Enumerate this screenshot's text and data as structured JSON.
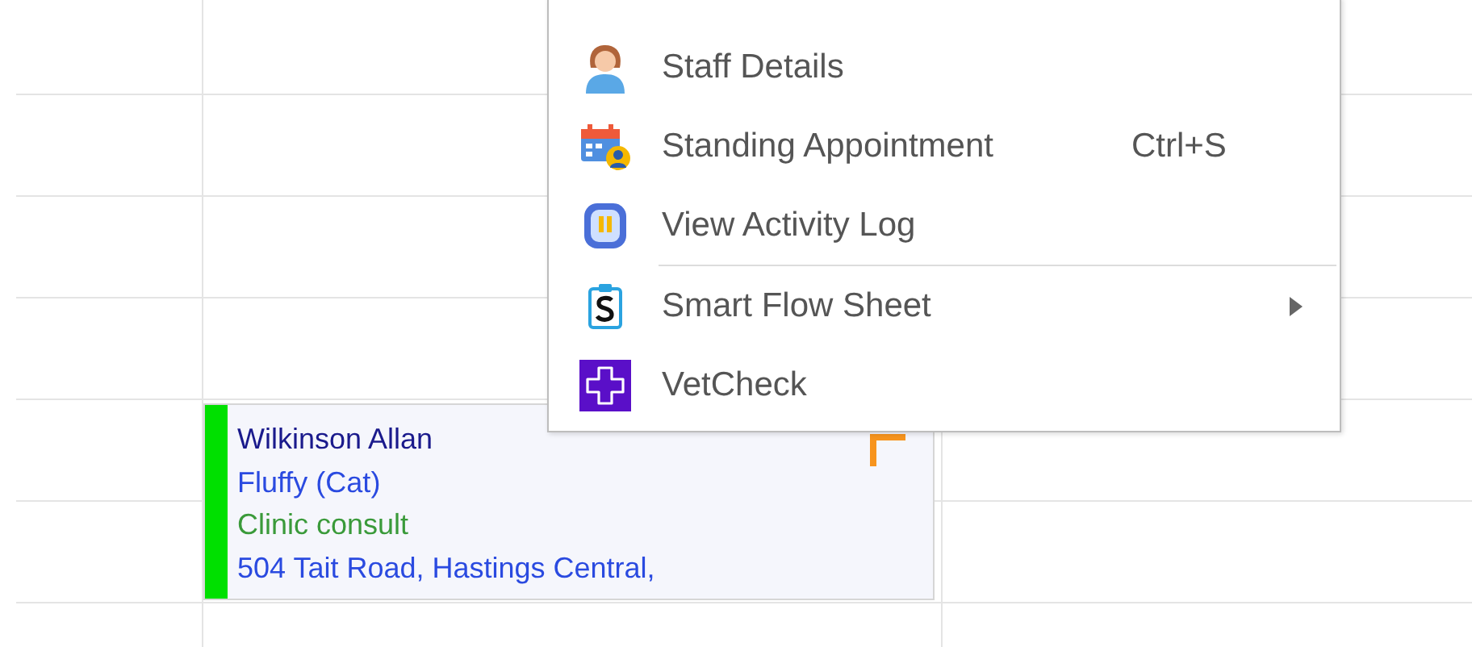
{
  "appointment": {
    "owner": "Wilkinson Allan",
    "patient": "Fluffy (Cat)",
    "type": "Clinic consult",
    "address": "504 Tait Road, Hastings Central,",
    "color": "#00e000",
    "flagged": true
  },
  "context_menu": {
    "items": [
      {
        "kind": "item",
        "label": "Staff Details",
        "submenu": false
      },
      {
        "kind": "item",
        "label": "Standing Appointment",
        "shortcut": "Ctrl+S",
        "submenu": false
      },
      {
        "kind": "item",
        "label": "View Activity Log",
        "submenu": false
      },
      {
        "kind": "separator"
      },
      {
        "kind": "item",
        "label": "Smart Flow Sheet",
        "submenu": true
      },
      {
        "kind": "item",
        "label": "VetCheck",
        "submenu": false
      }
    ]
  }
}
